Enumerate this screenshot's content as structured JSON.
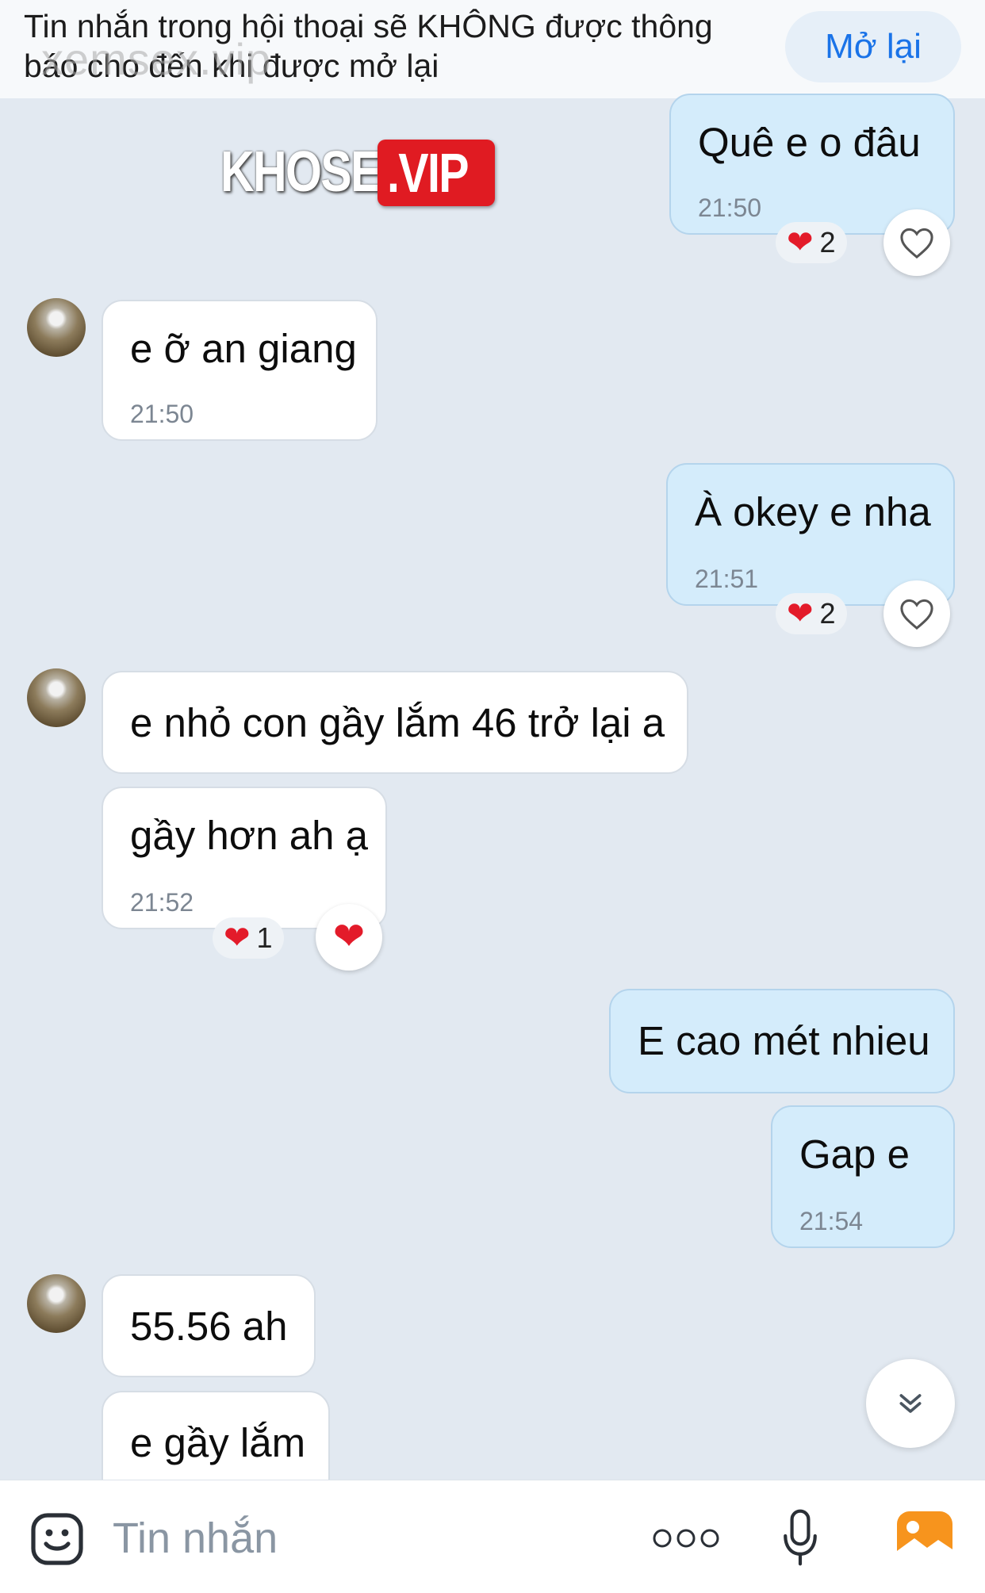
{
  "banner": {
    "text": "Tin nhắn trong hội thoại sẽ KHÔNG được thông báo cho đến khi được mở lại",
    "reopen_label": "Mở lại",
    "watermark": "xemsex.vip"
  },
  "logo": {
    "part1": "KHOSEX",
    "part2": ".VIP"
  },
  "messages": [
    {
      "side": "out",
      "text": "Quê  e o đâu",
      "time": "21:50",
      "reaction_count": "2"
    },
    {
      "side": "in",
      "text": "e ỡ an giang",
      "time": "21:50"
    },
    {
      "side": "out",
      "text": "À okey e nha",
      "time": "21:51",
      "reaction_count": "2"
    },
    {
      "side": "in",
      "text": "e nhỏ con gầy lắm 46 trở lại a"
    },
    {
      "side": "in",
      "text": "gầy hơn ah ạ",
      "time": "21:52",
      "reaction_count": "1"
    },
    {
      "side": "out",
      "text": "E cao mét nhieu"
    },
    {
      "side": "out",
      "text": "Gap e",
      "time": "21:54"
    },
    {
      "side": "in",
      "text": "55.56 ah"
    },
    {
      "side": "in",
      "text": "e gầy lắm"
    }
  ],
  "composer": {
    "placeholder": "Tin nhắn",
    "icons": [
      "sticker-icon",
      "more-icon",
      "microphone-icon",
      "gallery-icon"
    ]
  },
  "colors": {
    "background": "#e2e9f1",
    "outgoing_bubble": "#d4ecfb",
    "incoming_bubble": "#ffffff",
    "accent": "#1a73e8",
    "heart": "#e31b2a"
  }
}
